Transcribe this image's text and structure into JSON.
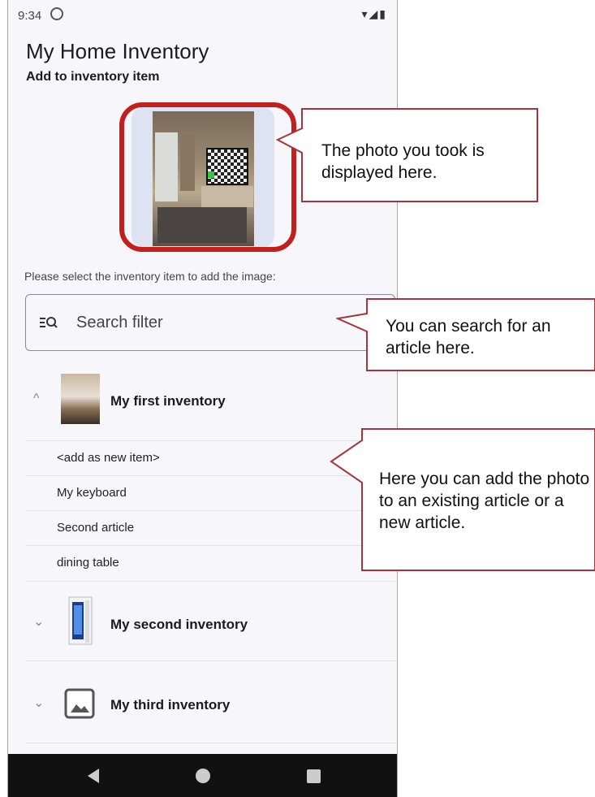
{
  "status": {
    "time": "9:34",
    "icons_right": "▾◢▮"
  },
  "app": {
    "title": "My Home Inventory",
    "subtitle": "Add to inventory item"
  },
  "prompt": "Please select the inventory item to add the image:",
  "search": {
    "placeholder": "Search filter",
    "value": ""
  },
  "inventories": [
    {
      "name": "My first inventory",
      "expanded": true,
      "chevron": "^",
      "items": [
        "<add as new item>",
        "My keyboard",
        "Second article",
        "dining table"
      ]
    },
    {
      "name": "My second inventory",
      "expanded": false,
      "chevron": "⌄"
    },
    {
      "name": "My third inventory",
      "expanded": false,
      "chevron": "⌄"
    }
  ],
  "callouts": {
    "photo": "The photo you took is displayed here.",
    "search": "You can search for an article here.",
    "items": "Here you can add the photo to an existing article or a new article."
  },
  "colors": {
    "highlight": "#c0211c",
    "callout_border": "#a8333a",
    "background": "#f7f6fb"
  },
  "icons": {
    "search": "filter-search-icon",
    "nav": [
      "back-icon",
      "home-icon",
      "recents-icon"
    ],
    "thumbnails": [
      "room-photo",
      "pc-tower-photo",
      "image-placeholder-icon"
    ]
  }
}
